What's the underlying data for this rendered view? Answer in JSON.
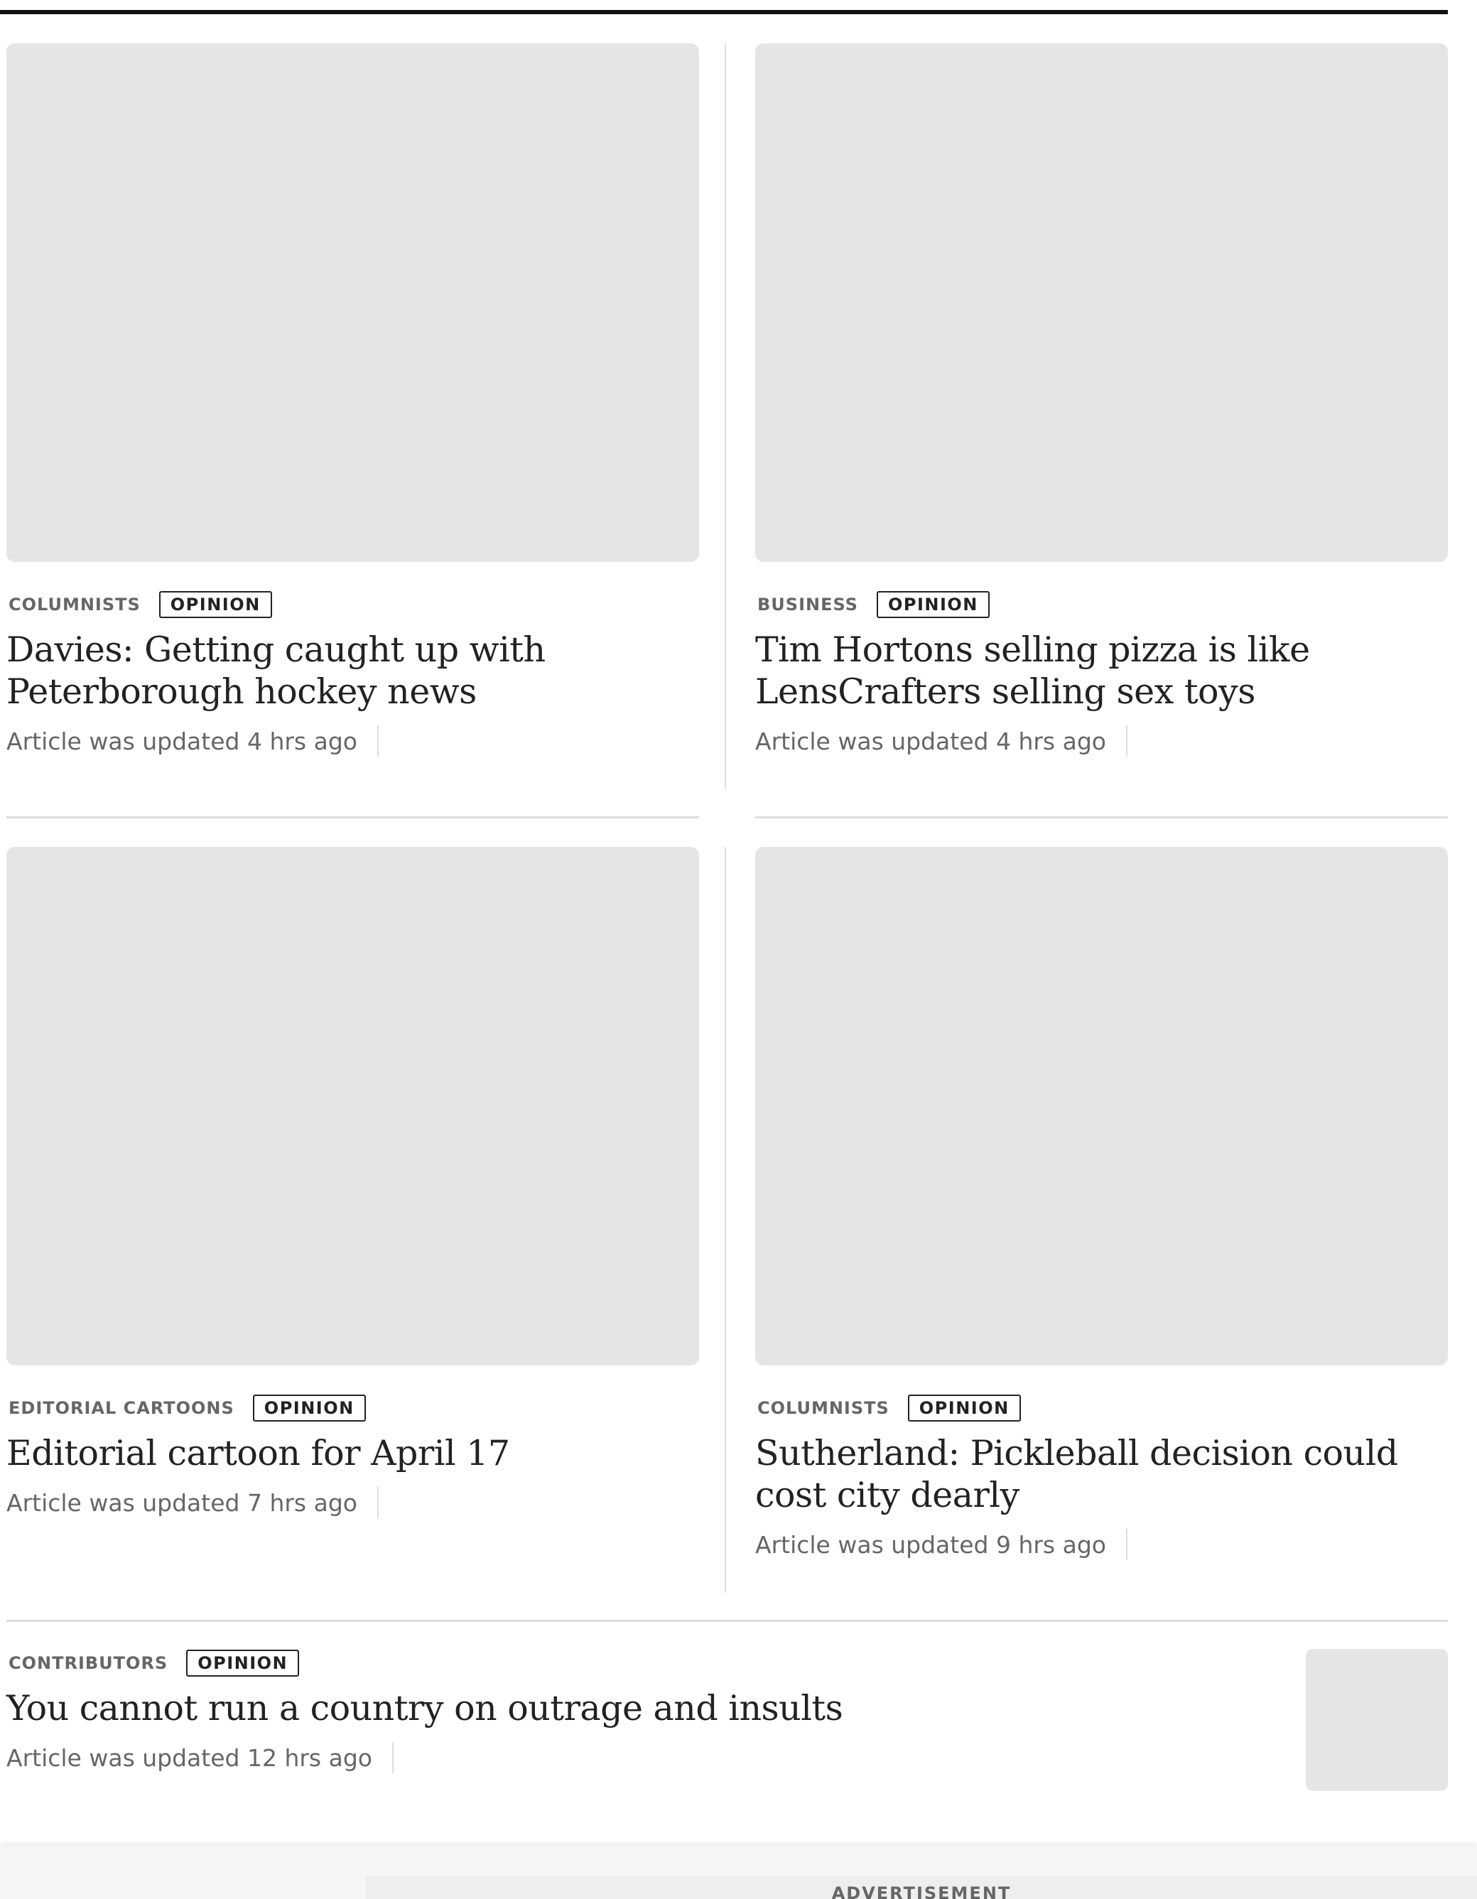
{
  "cards": [
    {
      "category": "COLUMNISTS",
      "badge": "OPINION",
      "headline": "Davies: Getting caught up with Peterborough hockey news",
      "timestamp": "Article was updated 4 hrs ago"
    },
    {
      "category": "BUSINESS",
      "badge": "OPINION",
      "headline": "Tim Hortons selling pizza is like LensCrafters selling sex toys",
      "timestamp": "Article was updated 4 hrs ago"
    },
    {
      "category": "EDITORIAL CARTOONS",
      "badge": "OPINION",
      "headline": "Editorial cartoon for April 17",
      "timestamp": "Article was updated 7 hrs ago"
    },
    {
      "category": "COLUMNISTS",
      "badge": "OPINION",
      "headline": "Sutherland: Pickleball decision could cost city dearly",
      "timestamp": "Article was updated 9 hrs ago"
    }
  ],
  "list_item": {
    "category": "CONTRIBUTORS",
    "badge": "OPINION",
    "headline": "You cannot run a country on outrage and insults",
    "timestamp": "Article was updated 12 hrs ago"
  },
  "advertisement": {
    "label": "ADVERTISEMENT"
  }
}
